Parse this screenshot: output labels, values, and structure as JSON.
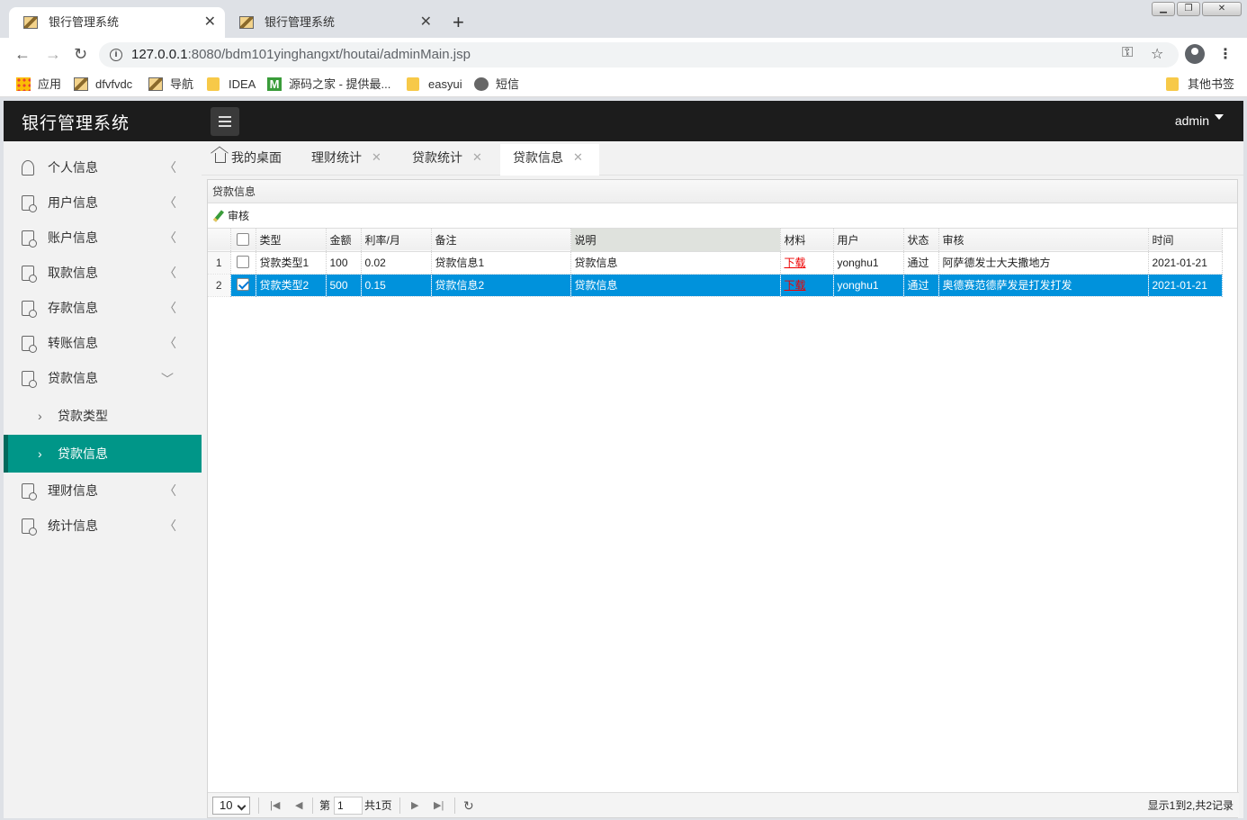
{
  "browser": {
    "tabs": [
      {
        "title": "银行管理系统",
        "active": true
      },
      {
        "title": "银行管理系统",
        "active": false
      }
    ],
    "url_host": "127.0.0.1",
    "url_rest": ":8080/bdm101yinghangxt/houtai/adminMain.jsp",
    "bookmarks": [
      "应用",
      "dfvfvdc",
      "导航",
      "IDEA",
      "源码之家 - 提供最...",
      "easyui",
      "短信"
    ],
    "other_bookmarks": "其他书签"
  },
  "app": {
    "title": "银行管理系统",
    "user": "admin"
  },
  "sidebar": {
    "items": [
      {
        "label": "个人信息"
      },
      {
        "label": "用户信息"
      },
      {
        "label": "账户信息"
      },
      {
        "label": "取款信息"
      },
      {
        "label": "存款信息"
      },
      {
        "label": "转账信息"
      },
      {
        "label": "贷款信息",
        "expanded": true
      },
      {
        "label": "理财信息"
      },
      {
        "label": "统计信息"
      }
    ],
    "sub_items": [
      {
        "label": "贷款类型"
      },
      {
        "label": "贷款信息",
        "active": true
      }
    ]
  },
  "content_tabs": [
    {
      "label": "我的桌面"
    },
    {
      "label": "理财统计"
    },
    {
      "label": "贷款统计"
    },
    {
      "label": "贷款信息",
      "active": true
    }
  ],
  "panel": {
    "title": "贷款信息",
    "toolbar_button": "审核"
  },
  "grid": {
    "columns": [
      "类型",
      "金额",
      "利率/月",
      "备注",
      "说明",
      "材料",
      "用户",
      "状态",
      "审核",
      "时间"
    ],
    "rows": [
      {
        "num": "1",
        "checked": false,
        "selected": false,
        "cells": [
          "贷款类型1",
          "100",
          "0.02",
          "贷款信息1",
          "贷款信息",
          "下载",
          "yonghu1",
          "通过",
          "阿萨德发士大夫撒地方",
          "2021-01-21"
        ]
      },
      {
        "num": "2",
        "checked": true,
        "selected": true,
        "cells": [
          "贷款类型2",
          "500",
          "0.15",
          "贷款信息2",
          "贷款信息",
          "下载",
          "yonghu1",
          "通过",
          "奥德赛范德萨发是打发打发",
          "2021-01-21"
        ]
      }
    ]
  },
  "pager": {
    "page_size": "10",
    "page_prefix": "第",
    "page_value": "1",
    "page_total": "共1页",
    "info": "显示1到2,共2记录"
  },
  "colors": {
    "header_bg": "#1c1c1c",
    "sidebar_active": "#009688",
    "row_selected": "#0092dc",
    "link_red": "#e00000"
  }
}
